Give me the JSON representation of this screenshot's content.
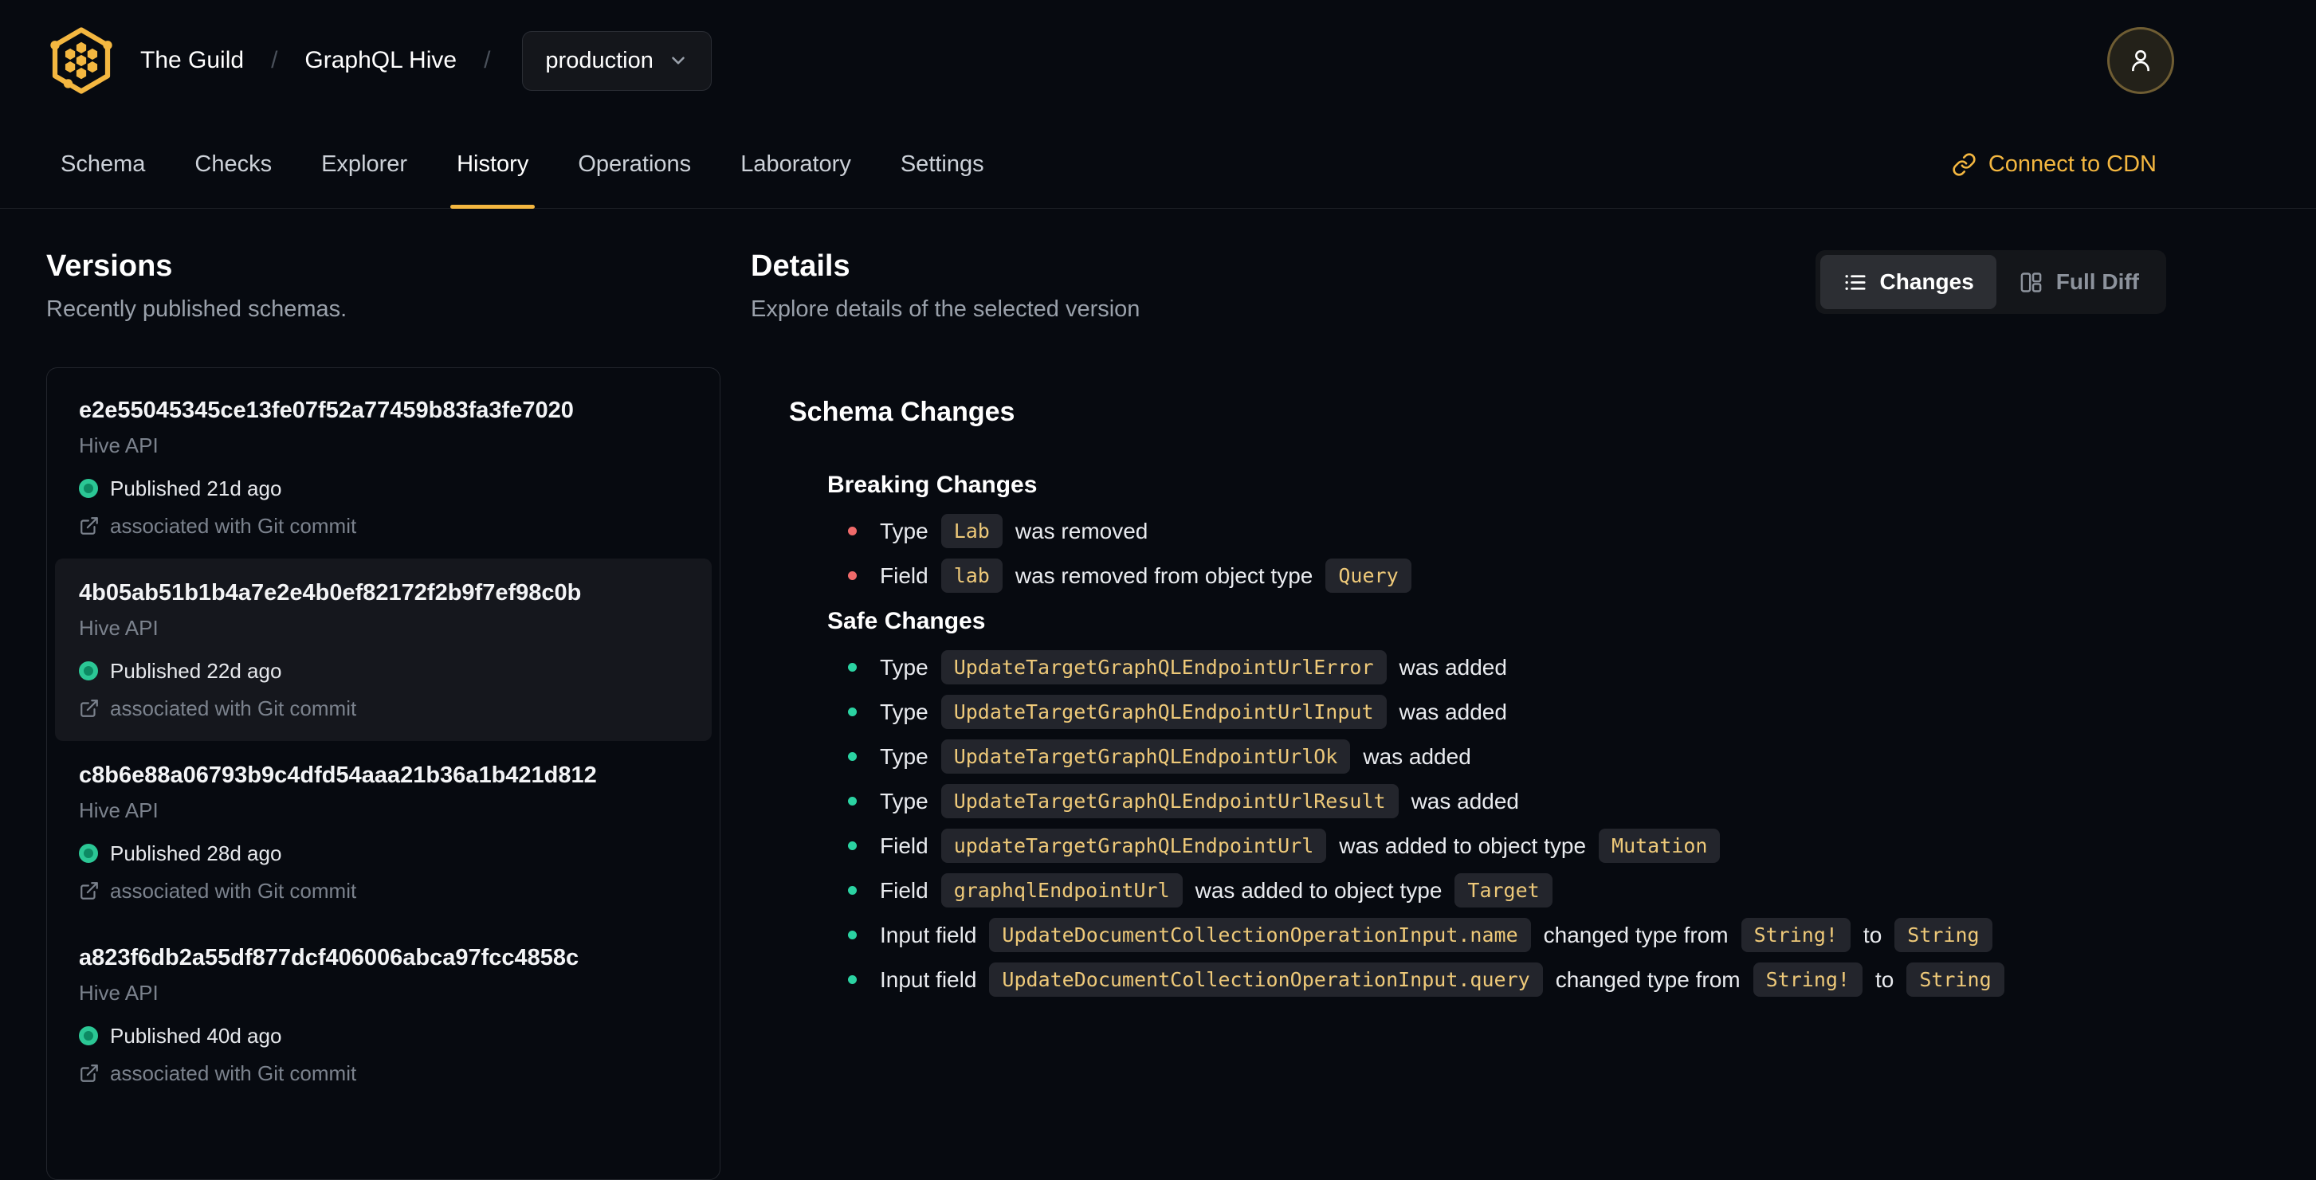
{
  "brand": {
    "org": "The Guild",
    "separator": "/",
    "project": "GraphQL Hive",
    "target": "production"
  },
  "header": {
    "connect_cdn_label": "Connect to CDN"
  },
  "tabs": [
    {
      "label": "Schema"
    },
    {
      "label": "Checks"
    },
    {
      "label": "Explorer"
    },
    {
      "label": "History",
      "active": true
    },
    {
      "label": "Operations"
    },
    {
      "label": "Laboratory"
    },
    {
      "label": "Settings"
    }
  ],
  "versions": {
    "title": "Versions",
    "subtitle": "Recently published schemas.",
    "items": [
      {
        "hash": "e2e55045345ce13fe07f52a77459b83fa3fe7020",
        "service": "Hive API",
        "status": "Published 21d ago",
        "git": "associated with Git commit",
        "selected": false
      },
      {
        "hash": "4b05ab51b1b4a7e2e4b0ef82172f2b9f7ef98c0b",
        "service": "Hive API",
        "status": "Published 22d ago",
        "git": "associated with Git commit",
        "selected": true
      },
      {
        "hash": "c8b6e88a06793b9c4dfd54aaa21b36a1b421d812",
        "service": "Hive API",
        "status": "Published 28d ago",
        "git": "associated with Git commit",
        "selected": false
      },
      {
        "hash": "a823f6db2a55df877dcf406006abca97fcc4858c",
        "service": "Hive API",
        "status": "Published 40d ago",
        "git": "associated with Git commit",
        "selected": false
      }
    ]
  },
  "details": {
    "title": "Details",
    "subtitle": "Explore details of the selected version",
    "toggle": {
      "changes": "Changes",
      "full_diff": "Full Diff"
    },
    "schema_changes_title": "Schema Changes",
    "breaking": {
      "title": "Breaking Changes",
      "items": [
        {
          "label": "Type",
          "code": "Lab",
          "text1": "was removed"
        },
        {
          "label": "Field",
          "code": "lab",
          "text1": "was removed from object type",
          "code2": "Query"
        }
      ]
    },
    "safe": {
      "title": "Safe Changes",
      "items": [
        {
          "label": "Type",
          "code": "UpdateTargetGraphQLEndpointUrlError",
          "text1": "was added"
        },
        {
          "label": "Type",
          "code": "UpdateTargetGraphQLEndpointUrlInput",
          "text1": "was added"
        },
        {
          "label": "Type",
          "code": "UpdateTargetGraphQLEndpointUrlOk",
          "text1": "was added"
        },
        {
          "label": "Type",
          "code": "UpdateTargetGraphQLEndpointUrlResult",
          "text1": "was added"
        },
        {
          "label": "Field",
          "code": "updateTargetGraphQLEndpointUrl",
          "text1": "was added to object type",
          "code2": "Mutation"
        },
        {
          "label": "Field",
          "code": "graphqlEndpointUrl",
          "text1": "was added to object type",
          "code2": "Target"
        },
        {
          "label": "Input field",
          "code": "UpdateDocumentCollectionOperationInput.name",
          "text1": "changed type from",
          "code2": "String!",
          "text2": "to",
          "code3": "String"
        },
        {
          "label": "Input field",
          "code": "UpdateDocumentCollectionOperationInput.query",
          "text1": "changed type from",
          "code2": "String!",
          "text2": "to",
          "code3": "String"
        }
      ]
    }
  },
  "icons": [
    "hive-logo",
    "chevron-down-icon",
    "user-icon",
    "link-icon",
    "external-link-icon",
    "list-icon",
    "columns-icon"
  ],
  "colors": {
    "accent": "#f4b740",
    "breaking_bullet": "#ef6a6a",
    "safe_bullet": "#2bd3a2",
    "published_dot": "#2bc795",
    "code_text": "#eec979",
    "background": "#070a10"
  }
}
